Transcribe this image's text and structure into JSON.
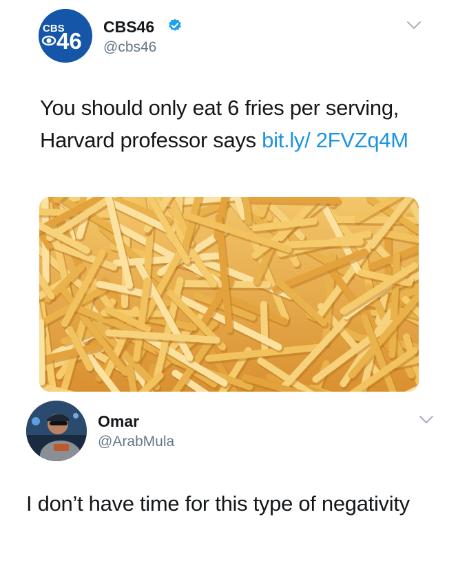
{
  "colors": {
    "link": "#1b95e0",
    "verified_badge": "#1da1f2",
    "cbs_blue": "#1556a8",
    "handle_gray": "#657786",
    "fries_gold": "#e8a43a"
  },
  "tweet": {
    "author": {
      "name": "CBS46",
      "handle": "@cbs46",
      "verified": true,
      "avatar_logo_top": "CBS",
      "avatar_logo_number": "46"
    },
    "text_part1": "You should only eat 6 fries per serving, Harvard professor says ",
    "link_text": "bit.ly/ 2FVZq4M",
    "media_icon": "french-fries-photo",
    "menu_icon": "chevron-down-icon"
  },
  "reply": {
    "author": {
      "name": "Omar",
      "handle": "@ArabMula"
    },
    "text": "I don’t have time for this type of negativity",
    "menu_icon": "chevron-down-icon"
  }
}
